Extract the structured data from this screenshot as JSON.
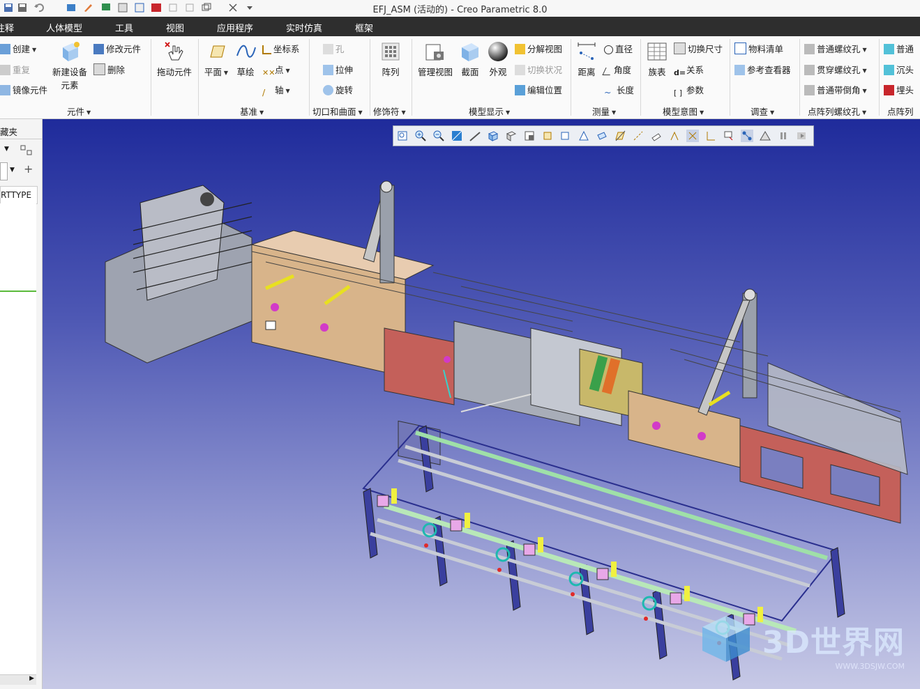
{
  "window": {
    "title": "EFJ_ASM (活动的) - Creo Parametric 8.0"
  },
  "menu_tabs": [
    "注释",
    "人体模型",
    "工具",
    "视图",
    "应用程序",
    "实时仿真",
    "框架"
  ],
  "ribbon": {
    "component": {
      "create": "创建",
      "redo": "重复",
      "mirror": "镜像元件",
      "new_device_l1": "新建设备",
      "new_device_l2": "元素",
      "modify": "修改元件",
      "delete": "删除",
      "drag": "拖动元件",
      "group": "元件"
    },
    "datum": {
      "plane": "平面",
      "sketch": "草绘",
      "csys": "坐标系",
      "point": "点",
      "axis": "轴",
      "group": "基准"
    },
    "cut": {
      "hole": "孔",
      "extrude": "拉伸",
      "revolve": "旋转",
      "group": "切口和曲面"
    },
    "modifier": {
      "pattern": "阵列",
      "group": "修饰符"
    },
    "display": {
      "manage_views": "管理视图",
      "section": "截面",
      "appearance": "外观",
      "explode_view": "分解视图",
      "toggle_state": "切换状况",
      "edit_position": "编辑位置",
      "group": "模型显示"
    },
    "measure": {
      "distance": "距离",
      "diameter": "直径",
      "angle": "角度",
      "length": "长度",
      "group": "测量"
    },
    "intent": {
      "family_table": "族表",
      "switch_dim": "切换尺寸",
      "relations": "关系",
      "params": "参数",
      "group": "模型意图"
    },
    "investigate": {
      "bom": "物料清单",
      "ref_viewer": "参考查看器",
      "group": "调查"
    },
    "thread": {
      "std_thread": "普通螺纹孔",
      "thru_thread": "贯穿螺纹孔",
      "chamfer": "普通带倒角",
      "group": "点阵列螺纹孔"
    },
    "thread2": {
      "std": "普通",
      "counterbore": "沉头",
      "embed": "埋头",
      "group": "点阵列"
    }
  },
  "left_panel": {
    "header": "藏夹",
    "column": "RTTYPE"
  },
  "watermark": {
    "brand": "3D世界网",
    "url": "WWW.3DSJW.COM"
  },
  "colors": {
    "tab_bg": "#2e2e2e",
    "viewport_top": "#1f2b9b",
    "viewport_bottom": "#c7c9e6",
    "frame_tan": "#d8b48a",
    "frame_red": "#c4605a",
    "frame_blue": "#3a3f9e"
  }
}
